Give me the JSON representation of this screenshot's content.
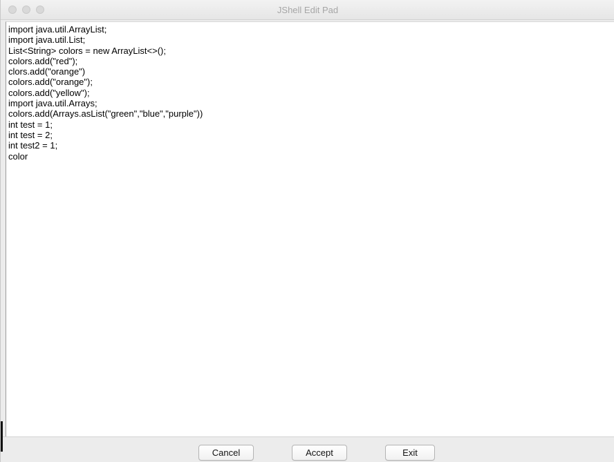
{
  "window": {
    "title": "JShell Edit Pad",
    "traffic_lights": [
      "close",
      "minimize",
      "zoom"
    ]
  },
  "editor": {
    "lines": [
      "import java.util.ArrayList;",
      "import java.util.List;",
      "List<String> colors = new ArrayList<>();",
      "colors.add(\"red\");",
      "clors.add(\"orange\")",
      "colors.add(\"orange\");",
      "colors.add(\"yellow\");",
      "import java.util.Arrays;",
      "colors.add(Arrays.asList(\"green\",\"blue\",\"purple\"))",
      "int test = 1;",
      "int test = 2;",
      "int test2 = 1;",
      "color"
    ]
  },
  "buttons": {
    "cancel_label": "Cancel",
    "accept_label": "Accept",
    "exit_label": "Exit"
  }
}
